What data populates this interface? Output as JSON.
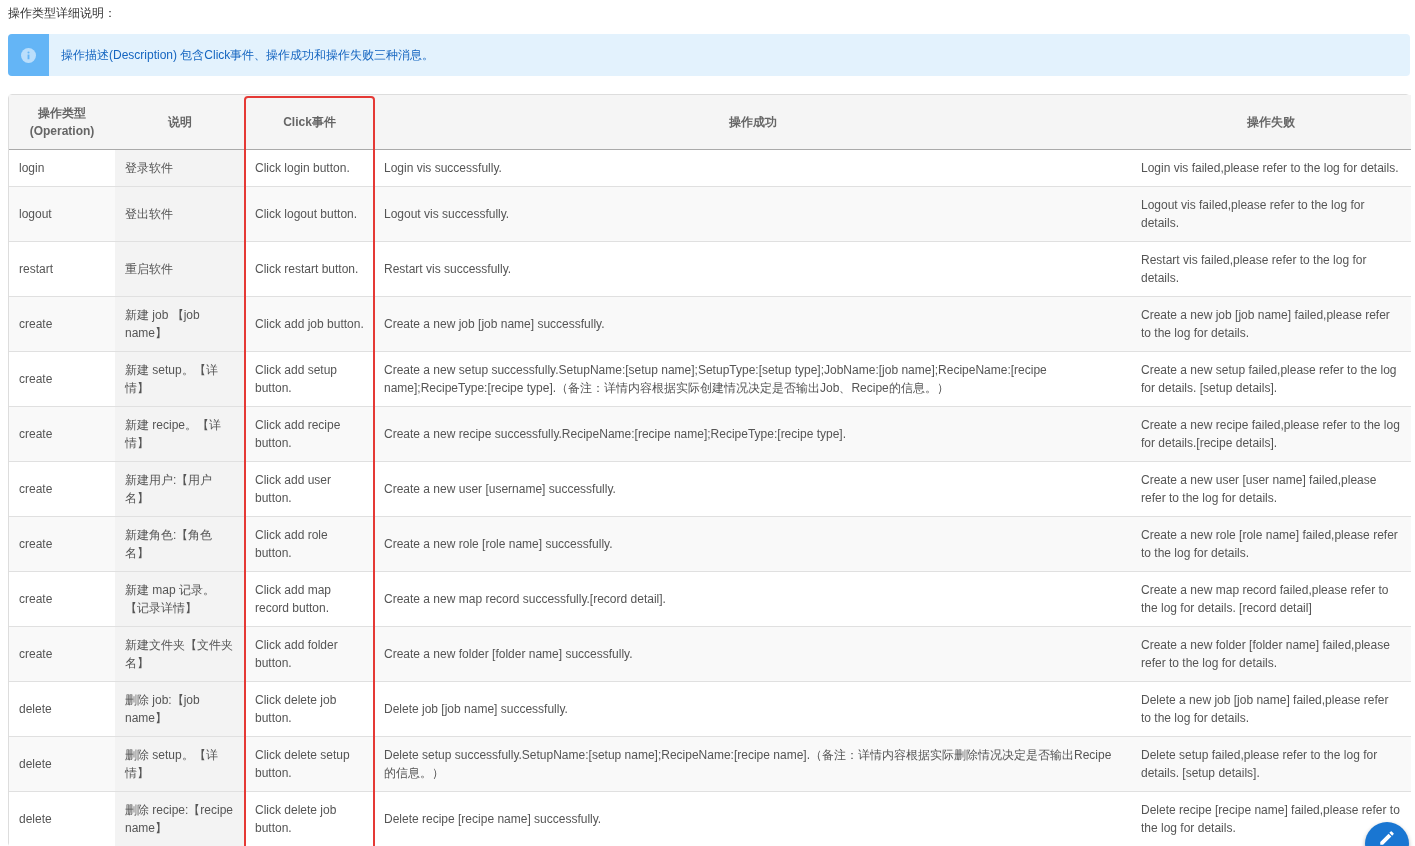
{
  "heading": "操作类型详细说明：",
  "alert": {
    "text": "操作描述(Description) 包含Click事件、操作成功和操作失败三种消息。"
  },
  "table": {
    "columns": [
      {
        "label": "操作类型(Operation)",
        "highlighted": false
      },
      {
        "label": "说明",
        "highlighted": false
      },
      {
        "label": "Click事件",
        "highlighted": true
      },
      {
        "label": "操作成功",
        "highlighted": false
      },
      {
        "label": "操作失败",
        "highlighted": false
      }
    ],
    "rows": [
      [
        "login",
        "登录软件",
        "Click login button.",
        "Login vis successfully.",
        "Login vis failed,please refer to the log for details."
      ],
      [
        "logout",
        "登出软件",
        "Click logout button.",
        "Logout vis successfully.",
        "Logout vis failed,please refer to the log for details."
      ],
      [
        "restart",
        "重启软件",
        "Click restart button.",
        "Restart vis successfully.",
        "Restart vis failed,please refer to the log for details."
      ],
      [
        "create",
        "新建 job 【job name】",
        "Click add job button.",
        "Create a new job [job name] successfully.",
        "Create a new job [job name] failed,please refer to the log for details."
      ],
      [
        "create",
        "新建 setup。【详情】",
        "Click add setup button.",
        "Create a new setup successfully.SetupName:[setup name];SetupType:[setup type];JobName:[job name];RecipeName:[recipe name];RecipeType:[recipe type].（备注：详情内容根据实际创建情况决定是否输出Job、Recipe的信息。）",
        "Create a new setup failed,please refer to the log for details. [setup details]."
      ],
      [
        "create",
        "新建 recipe。【详情】",
        "Click add recipe button.",
        "Create a new recipe successfully.RecipeName:[recipe name];RecipeType:[recipe type].",
        "Create a new recipe failed,please refer to the log for details.[recipe details]."
      ],
      [
        "create",
        "新建用户:【用户名】",
        "Click add user button.",
        "Create a new user [username] successfully.",
        "Create a new user [user name] failed,please refer to the log for details."
      ],
      [
        "create",
        "新建角色:【角色名】",
        "Click add role button.",
        "Create a new role [role name] successfully.",
        "Create a new role [role name] failed,please refer to the log for details."
      ],
      [
        "create",
        "新建 map 记录。【记录详情】",
        "Click add map record button.",
        "Create a new map record successfully.[record detail].",
        "Create a new map record failed,please refer to the log for details. [record detail]"
      ],
      [
        "create",
        "新建文件夹【文件夹名】",
        "Click add folder button.",
        "Create a new folder [folder name] successfully.",
        "Create a new folder [folder name] failed,please refer to the log for details."
      ],
      [
        "delete",
        "删除 job:【job name】",
        "Click delete job button.",
        "Delete job [job name] successfully.",
        "Delete a new job [job name] failed,please refer to the log for details."
      ],
      [
        "delete",
        "删除 setup。【详情】",
        "Click delete setup button.",
        "Delete setup successfully.SetupName:[setup name];RecipeName:[recipe name].（备注：详情内容根据实际删除情况决定是否输出Recipe的信息。）",
        "Delete setup failed,please refer to the log for details. [setup details]."
      ],
      [
        "delete",
        "删除 recipe:【recipe name】",
        "Click delete job button.",
        "Delete recipe [recipe name] successfully.",
        "Delete recipe [recipe name] failed,please refer to the log for details."
      ]
    ]
  }
}
